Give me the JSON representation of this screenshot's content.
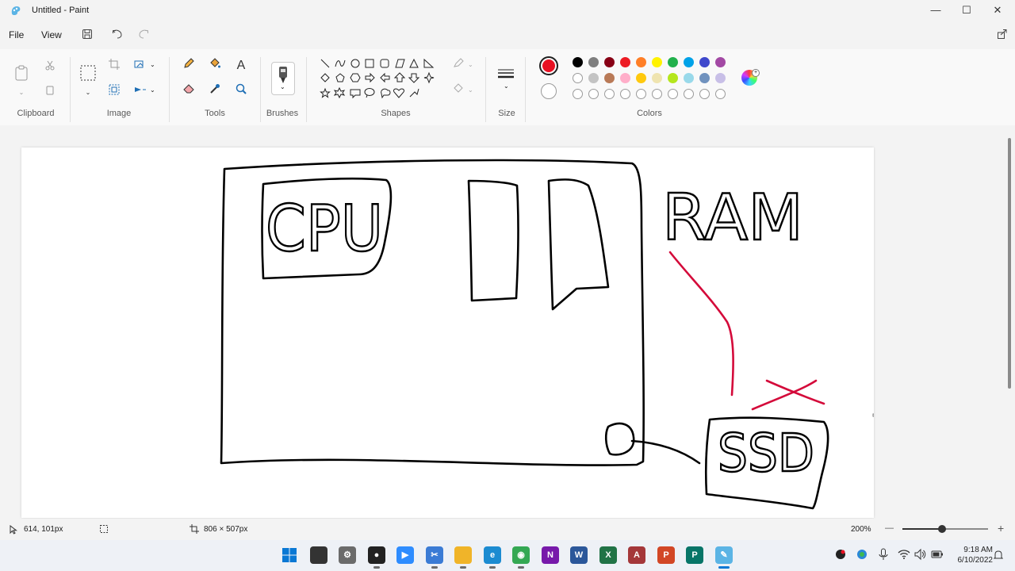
{
  "window": {
    "title": "Untitled - Paint",
    "app_icon": "paint-app-icon",
    "minimize_glyph": "—",
    "maximize_glyph": "☐",
    "close_glyph": "✕"
  },
  "menu": {
    "file_label": "File",
    "view_label": "View"
  },
  "ribbon": {
    "groups": {
      "clipboard": "Clipboard",
      "image": "Image",
      "tools": "Tools",
      "brushes": "Brushes",
      "shapes": "Shapes",
      "size": "Size",
      "colors": "Colors"
    },
    "text_tool_glyph": "A",
    "colors": {
      "primary": "#e81123",
      "secondary": "#ffffff",
      "row1": [
        "#000000",
        "#7f7f7f",
        "#880015",
        "#ed1c24",
        "#ff7f27",
        "#fff200",
        "#22b14c",
        "#00a2e8",
        "#3f48cc",
        "#a349a4"
      ],
      "row2": [
        "#ffffff",
        "#c3c3c3",
        "#b97a57",
        "#ffaec9",
        "#ffc90e",
        "#efe4b0",
        "#b5e61d",
        "#99d9ea",
        "#7092be",
        "#c8bfe7"
      ],
      "row3_count": 10
    }
  },
  "canvas": {
    "drawing_labels": {
      "cpu": "CPU",
      "ram": "RAM",
      "ssd": "SSD"
    },
    "ink_color": "#000000",
    "accent_ink_color": "#d40a3a"
  },
  "status": {
    "cursor_position": "614, 101px",
    "canvas_size": "806 × 507px",
    "zoom_level": "200%",
    "zoom_out": "—",
    "zoom_in": "+",
    "zoom_fraction": 0.46
  },
  "taskbar": {
    "time": "9:18 AM",
    "date": "6/10/2022",
    "apps": [
      "start",
      "file-explorer",
      "settings",
      "obs",
      "zoom",
      "snipping-tool",
      "folder",
      "edge",
      "chrome",
      "onenote",
      "word",
      "excel",
      "access",
      "powerpoint",
      "publisher",
      "paint"
    ]
  }
}
